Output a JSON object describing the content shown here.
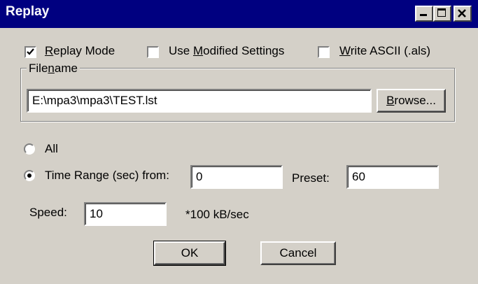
{
  "window": {
    "title": "Replay",
    "minimize_label": "_",
    "maximize_label": "□",
    "close_label": "×"
  },
  "options": {
    "replay_mode": {
      "prefix": "",
      "underline": "R",
      "rest": "eplay Mode",
      "checked": true
    },
    "use_modified": {
      "prefix": "Use ",
      "underline": "M",
      "rest": "odified Settings",
      "checked": false
    },
    "write_ascii": {
      "prefix": "",
      "underline": "W",
      "rest": "rite ASCII (.als)",
      "checked": false
    }
  },
  "filename": {
    "legend_prefix": "File",
    "legend_underline": "n",
    "legend_rest": "ame",
    "value": "E:\\mpa3\\mpa3\\TEST.lst",
    "browse_underline": "B",
    "browse_rest": "rowse..."
  },
  "range": {
    "all_label": "All",
    "all_selected": false,
    "time_label": "Time Range (sec) from:",
    "time_selected": true,
    "from_value": "0",
    "preset_label": "Preset:",
    "preset_value": "60"
  },
  "speed": {
    "label": "Speed:",
    "value": "10",
    "unit": "*100 kB/sec"
  },
  "buttons": {
    "ok": "OK",
    "cancel": "Cancel"
  }
}
